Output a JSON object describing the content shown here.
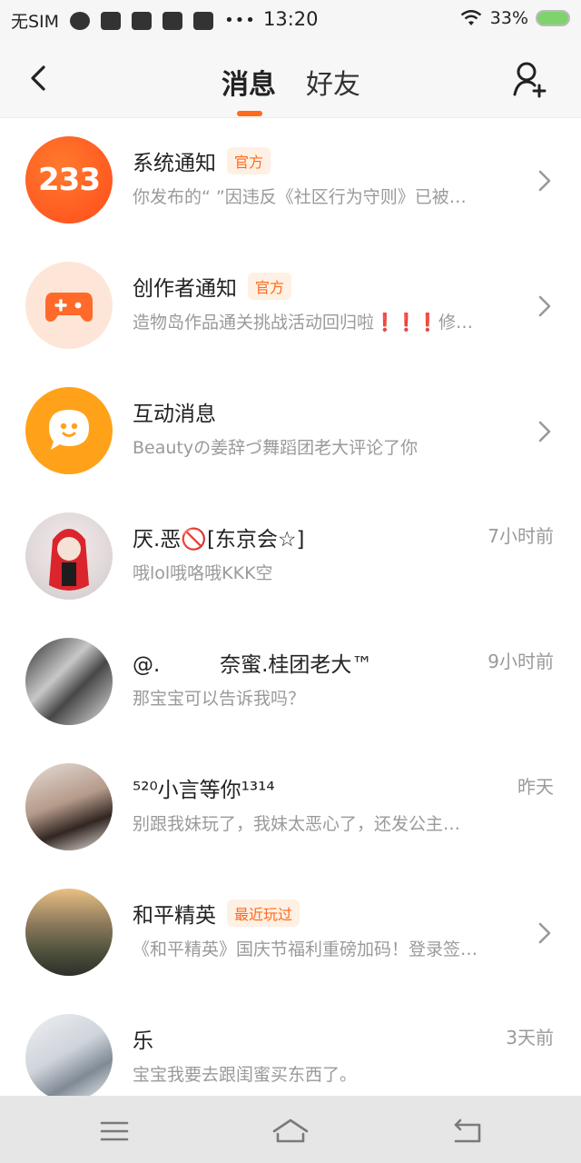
{
  "status_bar": {
    "carrier": "无SIM",
    "time": "13:20",
    "battery": "33%",
    "battery_color": "#7ed36d",
    "icons": [
      "browser-icon",
      "sms-icon",
      "notification-icon",
      "video-icon",
      "video-play-icon",
      "more-icon",
      "wifi-icon",
      "battery-icon"
    ]
  },
  "header": {
    "tabs": [
      {
        "label": "消息",
        "active": true
      },
      {
        "label": "好友",
        "active": false
      }
    ],
    "accent": "#ff6a1a"
  },
  "messages": [
    {
      "name": "系统通知",
      "tag": "官方",
      "preview": "你发布的“ ”因违反《社区行为守则》已被…",
      "time": "",
      "avatar_text": "233",
      "avatar": "system-logo"
    },
    {
      "name": "创作者通知",
      "tag": "官方",
      "preview": "造物岛作品通关挑战活动回归啦❗❗❗修…",
      "time": "",
      "avatar": "gamepad-icon"
    },
    {
      "name": "互动消息",
      "tag": "",
      "preview": "Beautyの姜辞づ舞蹈团老大评论了你",
      "time": "",
      "avatar": "chat-bubble-icon"
    },
    {
      "name": "厌.恶🚫[东京会☆]",
      "tag": "",
      "preview": "哦lol哦咯哦KKK空",
      "time": "7小时前",
      "avatar": "user-photo"
    },
    {
      "name": "@.         奈蜜.桂团老大™",
      "tag": "",
      "preview": "那宝宝可以告诉我吗？",
      "time": "9小时前",
      "avatar": "user-photo"
    },
    {
      "name": "⁵²⁰小言等你¹³¹⁴",
      "tag": "",
      "preview": "别跟我妹玩了，我妹太恶心了，还发公主…",
      "time": "昨天",
      "avatar": "user-photo"
    },
    {
      "name": "和平精英",
      "tag": "最近玩过",
      "preview": "《和平精英》国庆节福利重磅加码！登录签…",
      "time": "",
      "avatar": "game-icon"
    },
    {
      "name": "乐",
      "tag": "",
      "preview": "宝宝我要去跟闺蜜买东西了。",
      "time": "3天前",
      "avatar": "user-photo"
    }
  ],
  "nav_bar": {
    "icons": [
      "menu-icon",
      "home-icon",
      "back-icon"
    ]
  }
}
